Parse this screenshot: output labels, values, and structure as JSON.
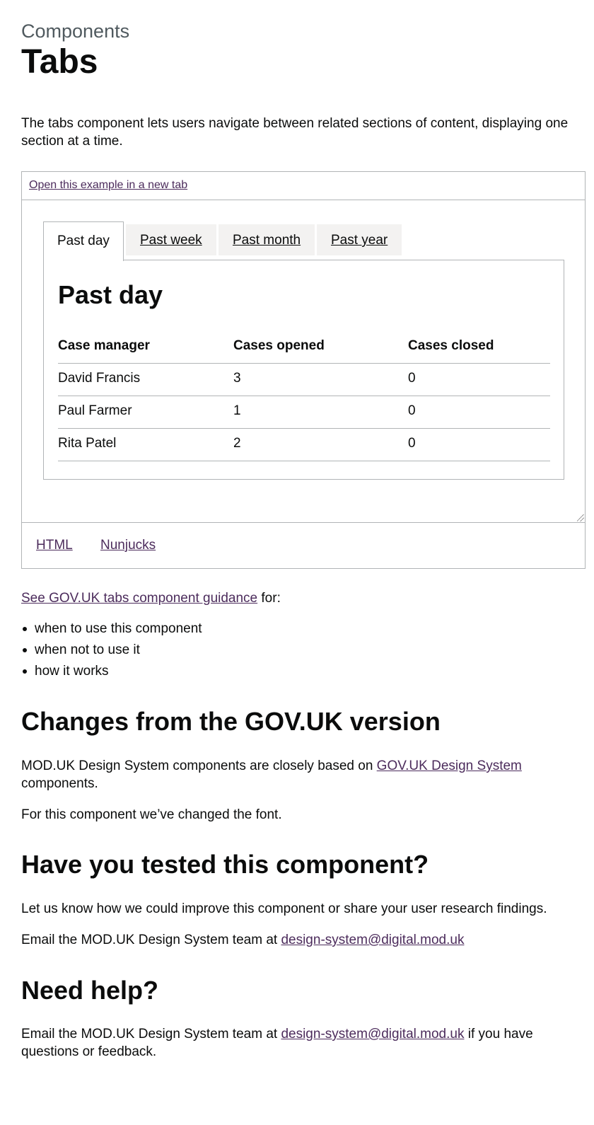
{
  "header": {
    "caption": "Components",
    "title": "Tabs"
  },
  "lede": "The tabs component lets users navigate between related sections of content, displaying one section at a time.",
  "example": {
    "open_link": "Open this example in a new tab",
    "tabs": [
      {
        "label": "Past day",
        "selected": true
      },
      {
        "label": "Past week",
        "selected": false
      },
      {
        "label": "Past month",
        "selected": false
      },
      {
        "label": "Past year",
        "selected": false
      }
    ],
    "panel": {
      "heading": "Past day",
      "table": {
        "headers": [
          "Case manager",
          "Cases opened",
          "Cases closed"
        ],
        "rows": [
          [
            "David Francis",
            "3",
            "0"
          ],
          [
            "Paul Farmer",
            "1",
            "0"
          ],
          [
            "Rita Patel",
            "2",
            "0"
          ]
        ]
      }
    },
    "code_tabs": [
      "HTML",
      "Nunjucks"
    ]
  },
  "guidance": {
    "link": "See GOV.UK tabs component guidance",
    "suffix": " for:",
    "bullets": [
      "when to use this component",
      "when not to use it",
      "how it works"
    ]
  },
  "changes": {
    "heading": "Changes from the GOV.UK version",
    "p1_text": "MOD.UK Design System components are closely based on ",
    "p1_link": "GOV.UK Design System",
    "p1_line2": "components.",
    "p2": "For this component we’ve changed the font."
  },
  "tested": {
    "heading": "Have you tested this component?",
    "p1": "Let us know how we could improve this component or share your user research findings.",
    "p2_text": "Email the MOD.UK Design System team at ",
    "p2_link": "design-system@digital.mod.uk"
  },
  "help": {
    "heading": "Need help?",
    "text": "Email the MOD.UK Design System team at ",
    "link": "design-system@digital.mod.uk",
    "suffix": " if you have",
    "line2": "questions or feedback."
  },
  "colors": {
    "text": "#0b0c0c",
    "link": "#4c2c5c",
    "border": "#b1b4b6",
    "tab_bg": "#f3f2f1",
    "caption": "#505a5f"
  }
}
